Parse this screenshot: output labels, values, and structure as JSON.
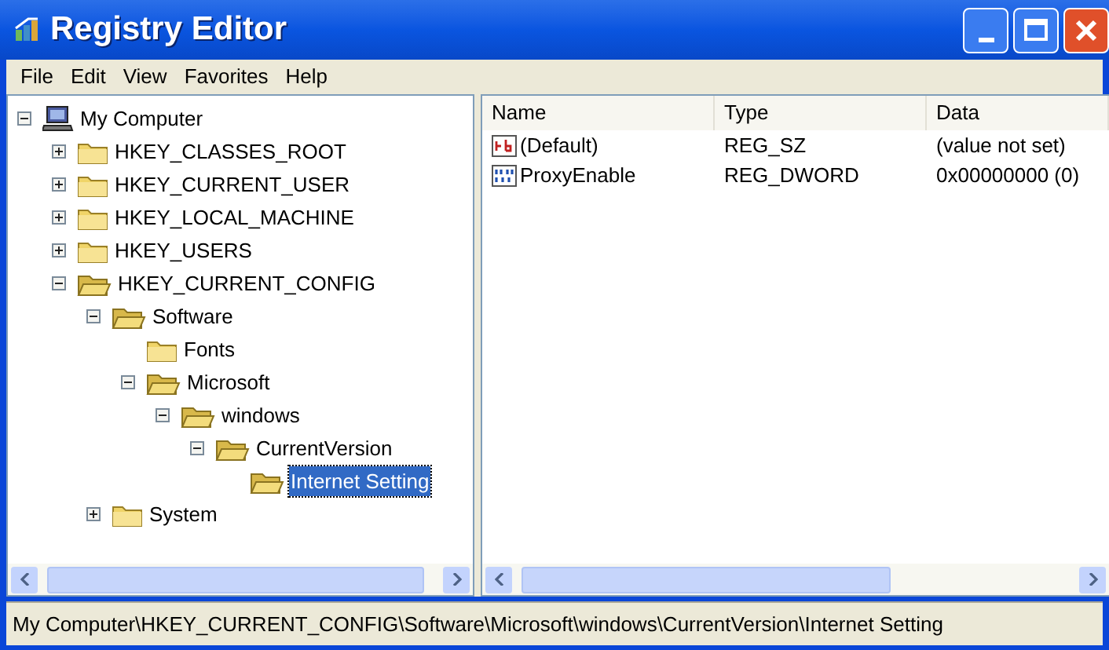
{
  "window": {
    "title": "Registry Editor"
  },
  "menu": [
    "File",
    "Edit",
    "View",
    "Favorites",
    "Help"
  ],
  "tree": [
    {
      "label": "My Computer",
      "kind": "computer",
      "has_children": true,
      "expanded": true,
      "selected": false,
      "children": [
        {
          "label": "HKEY_CLASSES_ROOT",
          "kind": "folder",
          "has_children": true,
          "expanded": false,
          "selected": false
        },
        {
          "label": "HKEY_CURRENT_USER",
          "kind": "folder",
          "has_children": true,
          "expanded": false,
          "selected": false
        },
        {
          "label": "HKEY_LOCAL_MACHINE",
          "kind": "folder",
          "has_children": true,
          "expanded": false,
          "selected": false
        },
        {
          "label": "HKEY_USERS",
          "kind": "folder",
          "has_children": true,
          "expanded": false,
          "selected": false
        },
        {
          "label": "HKEY_CURRENT_CONFIG",
          "kind": "folder",
          "has_children": true,
          "expanded": true,
          "selected": false,
          "children": [
            {
              "label": "Software",
              "kind": "folder",
              "has_children": true,
              "expanded": true,
              "selected": false,
              "children": [
                {
                  "label": "Fonts",
                  "kind": "folder",
                  "has_children": false,
                  "expanded": false,
                  "selected": false
                },
                {
                  "label": "Microsoft",
                  "kind": "folder",
                  "has_children": true,
                  "expanded": true,
                  "selected": false,
                  "children": [
                    {
                      "label": "windows",
                      "kind": "folder",
                      "has_children": true,
                      "expanded": true,
                      "selected": false,
                      "children": [
                        {
                          "label": "CurrentVersion",
                          "kind": "folder",
                          "has_children": true,
                          "expanded": true,
                          "selected": false,
                          "children": [
                            {
                              "label": "Internet Setting",
                              "kind": "folder",
                              "has_children": false,
                              "expanded": true,
                              "selected": true
                            }
                          ]
                        }
                      ]
                    }
                  ]
                }
              ]
            },
            {
              "label": "System",
              "kind": "folder",
              "has_children": true,
              "expanded": false,
              "selected": false
            }
          ]
        }
      ]
    }
  ],
  "table": {
    "columns": [
      "Name",
      "Type",
      "Data"
    ],
    "rows": [
      {
        "kind": "string",
        "name": "(Default)",
        "type": "REG_SZ",
        "data": "(value not set)"
      },
      {
        "kind": "binary",
        "name": "ProxyEnable",
        "type": "REG_DWORD",
        "data": "0x00000000 (0)"
      }
    ]
  },
  "status_bar": "My Computer\\HKEY_CURRENT_CONFIG\\Software\\Microsoft\\windows\\CurrentVersion\\Internet Setting"
}
